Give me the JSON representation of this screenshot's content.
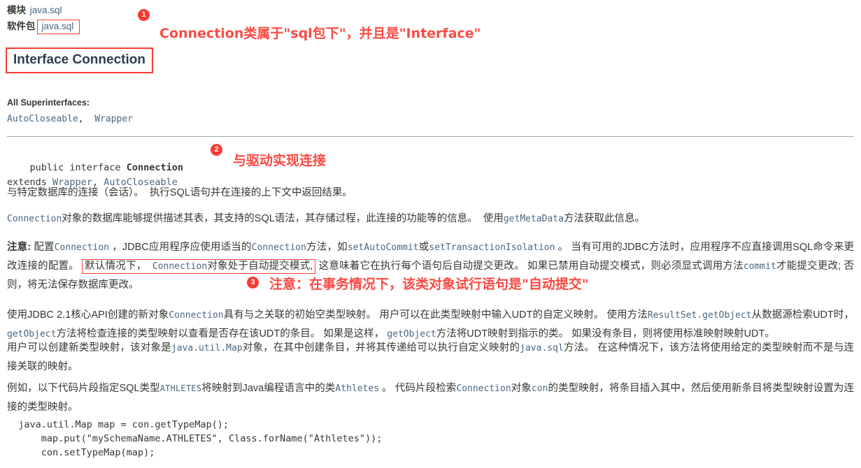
{
  "header": {
    "module_label": "模块",
    "module_value": "java.sql",
    "package_label": "软件包",
    "package_value": "java.sql",
    "type_title": "Interface Connection"
  },
  "annotations": {
    "accent_color": "#fb4a43",
    "items": [
      {
        "number": "1",
        "text": "Connection类属于\"sql包下\"，并且是\"Interface\""
      },
      {
        "number": "2",
        "text": "与驱动实现连接"
      },
      {
        "number": "3",
        "text": "注意：在事务情况下，该类对象试行语句是\"自动提交\""
      }
    ]
  },
  "superinterfaces": {
    "label": "All Superinterfaces:",
    "items": [
      "AutoCloseable",
      "Wrapper"
    ],
    "separator": ","
  },
  "declaration": {
    "modifier": "public interface ",
    "name": "Connection",
    "extends_keyword": "extends ",
    "extends_types": [
      "Wrapper",
      "AutoCloseable"
    ]
  },
  "body": {
    "p1_a": "与特定数据库的连接（会话）。",
    "p1_b": "执行SQL语句并在连接的上下文中返回结果。",
    "p2_code": "Connection",
    "p2_a": "对象的数据库能够提供描述其表，其支持的SQL语法，其存储过程，此连接的功能等的信息。",
    "p2_code2": "getMetaData",
    "p2_b": "使用",
    "p2_c": "方法获取此信息。",
    "note_label": "注意:",
    "note_a": " 配置",
    "note_code1": "Connection",
    "note_b": " ，JDBC应用程序应使用适当的",
    "note_code2": "Connection",
    "note_c": "方法，如",
    "note_code3": "setAutoCommit",
    "note_d": "或",
    "note_code4": "setTransactionIsolation",
    "note_e": " 。 当有可用的JDBC方法时，应用程序不应直接调用SQL命令来更改连接的配置。 ",
    "boxed_a": "默认情况下，",
    "boxed_code": "Connection",
    "boxed_b": "对象处于自动提交模式,",
    "note_f": " 这意味着它在执行每个语句后自动提交更改。 如果已禁用自动提交模式，则必须显式调用方法",
    "note_code5": "commit",
    "note_g": "才能提交更改; 否则，将无法保存数据库更改。",
    "p3_a": "使用JDBC 2.1核心API创建的新对象",
    "p3_code1": "Connection",
    "p3_b": "具有与之关联的初始空类型映射。 用户可以在此类型映射中输入UDT的自定义映射。 使用方法",
    "p3_code2": "ResultSet.getObject",
    "p3_c": "从数据源检索UDT时， ",
    "p3_code3": "getObject",
    "p3_d": "方法将检查连接的类型映射以查看是否存在该UDT的条目。 如果是这样， ",
    "p3_code4": "getObject",
    "p3_e": "方法将UDT映射到指示的类。 如果没有条目，则将使用标准映射映射UDT。",
    "p4_a": "用户可以创建新类型映射，该对象是",
    "p4_code1": "java.util.Map",
    "p4_b": "对象，在其中创建条目，并将其传递给可以执行自定义映射的",
    "p4_code2": "java.sql",
    "p4_c": "方法。 在这种情况下，该方法将使用给定的类型映射而不是与连接关联的映射。",
    "p5_a": "例如，以下代码片段指定SQL类型",
    "p5_code1": "ATHLETES",
    "p5_b": "将映射到Java编程语言中的类",
    "p5_code2": "Athletes",
    "p5_c": " 。 代码片段检索",
    "p5_code3": "Connection",
    "p5_d": "对象",
    "p5_code4": "con",
    "p5_e": "的类型映射，将条目插入其中，然后使用新条目将类型映射设置为连接的类型映射。"
  },
  "code_sample": {
    "lines": [
      "  java.util.Map map = con.getTypeMap();",
      "      map.put(\"mySchemaName.ATHLETES\", Class.forName(\"Athletes\"));",
      "      con.setTypeMap(map);"
    ]
  }
}
